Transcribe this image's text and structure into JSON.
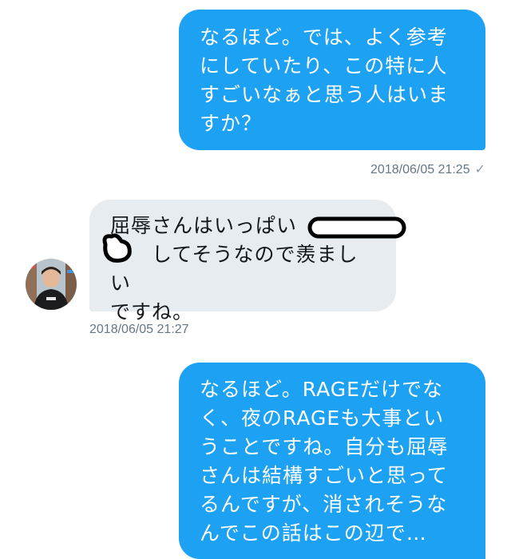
{
  "messages": [
    {
      "direction": "outgoing",
      "text": "なるほど。では、よく参考\nにしていたり、この特に人\nすごいなぁと思う人はいま\nすか？",
      "timestamp": "2018/06/05 21:25",
      "status_icon": "checkmark-icon"
    },
    {
      "direction": "incoming",
      "text": "屈辱さんはいっぱい\n　　してそうなので羨ましい\nですね。",
      "timestamp": "2018/06/05 21:27"
    },
    {
      "direction": "outgoing",
      "text": "なるほど。RAGEだけでな\nく、夜のRAGEも大事とい\nうことですね。自分も屈辱\nさんは結構すごいと思って\nるんですが、消されそうな\nんでこの話はこの辺で…"
    }
  ],
  "icons": {
    "read_check": "✓"
  },
  "colors": {
    "outgoing_bubble": "#1da1f2",
    "incoming_bubble": "#e6ecf0",
    "timestamp_text": "#657786"
  }
}
